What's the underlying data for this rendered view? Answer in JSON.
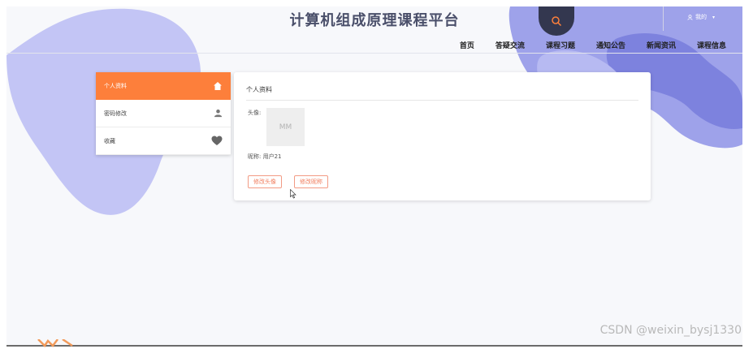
{
  "header": {
    "site_title": "计算机组成原理课程平台",
    "user_label": "我的"
  },
  "nav": [
    {
      "label": "首页"
    },
    {
      "label": "答疑交流"
    },
    {
      "label": "课程习题"
    },
    {
      "label": "通知公告"
    },
    {
      "label": "新闻资讯"
    },
    {
      "label": "课程信息"
    }
  ],
  "sidebar": {
    "items": [
      {
        "label": "个人资料",
        "icon": "home-icon",
        "active": true
      },
      {
        "label": "密码修改",
        "icon": "user-icon",
        "active": false
      },
      {
        "label": "收藏",
        "icon": "heart-icon",
        "active": false
      }
    ]
  },
  "profile": {
    "title": "个人资料",
    "avatar_label": "头像:",
    "avatar_placeholder": "MM",
    "nickname_label": "昵称:",
    "nickname_value": "用户21",
    "change_avatar_button": "修改头像",
    "change_nickname_button": "修改昵称"
  },
  "watermark": "CSDN @weixin_bysj1330",
  "colors": {
    "accent": "#fd7f3b",
    "blob": "#b9bcf2",
    "blob_dark": "#8e92e6",
    "search_bg": "#33374f"
  }
}
